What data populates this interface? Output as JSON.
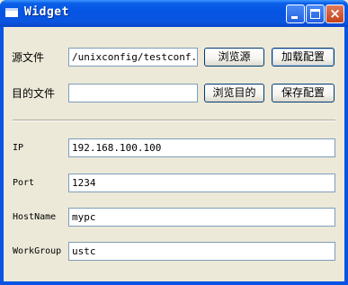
{
  "window": {
    "title": "Widget",
    "controls": {
      "minimize": "minimize",
      "maximize": "maximize",
      "close": "×"
    }
  },
  "source": {
    "label": "源文件",
    "value": "/unixconfig/testconf.txt",
    "browse_label": "浏览源",
    "load_label": "加载配置"
  },
  "target": {
    "label": "目的文件",
    "value": "",
    "browse_label": "浏览目的",
    "save_label": "保存配置"
  },
  "fields": [
    {
      "label": "IP",
      "value": "192.168.100.100"
    },
    {
      "label": "Port",
      "value": "1234"
    },
    {
      "label": "HostName",
      "value": "mypc"
    },
    {
      "label": "WorkGroup",
      "value": "ustc"
    }
  ]
}
